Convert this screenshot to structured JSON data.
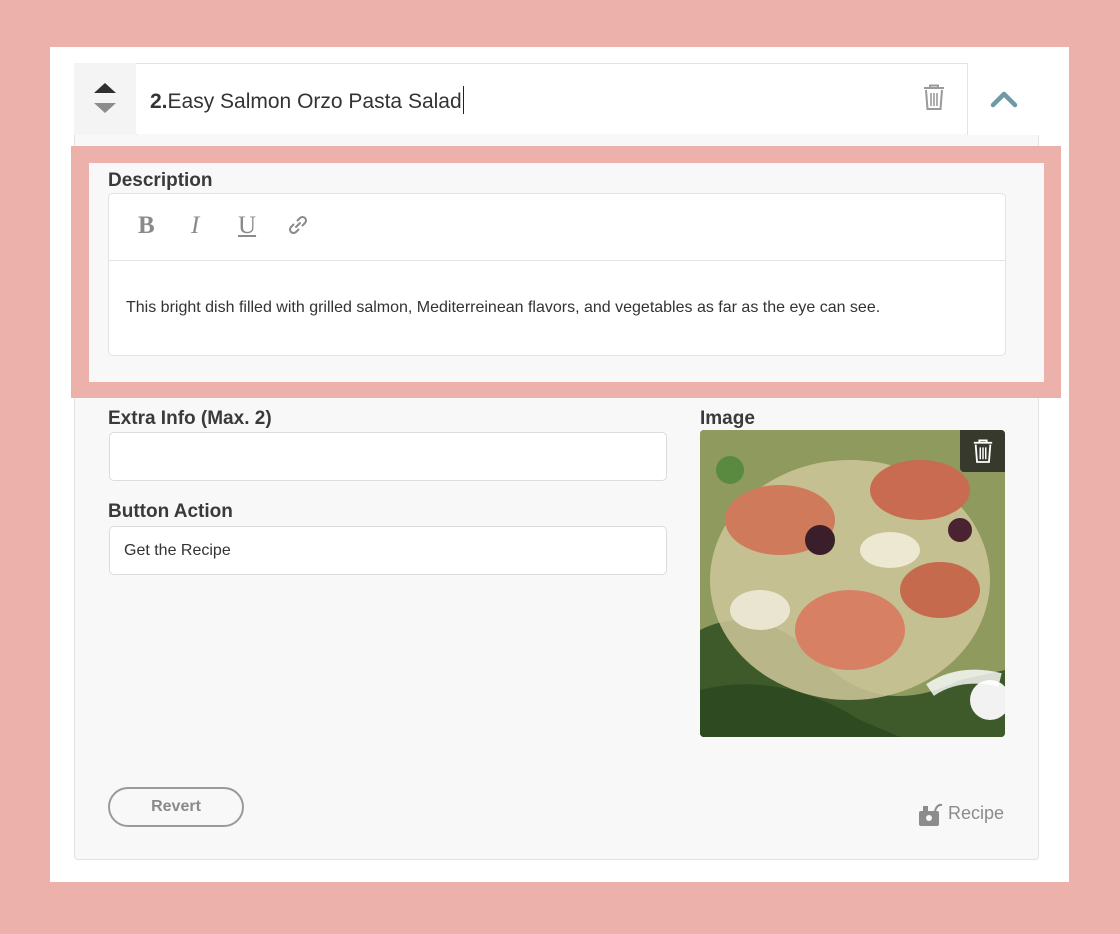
{
  "item": {
    "number": "2.",
    "title": "Easy Salmon Orzo Pasta Salad"
  },
  "description": {
    "label": "Description",
    "toolbar": {
      "bold": "B",
      "italic": "I",
      "underline": "U"
    },
    "text": "This bright dish filled with grilled salmon, Mediterreinean flavors, and vegetables as far as the eye can see."
  },
  "extra_info": {
    "label": "Extra Info (Max. 2)",
    "value": ""
  },
  "button_action": {
    "label": "Button Action",
    "value": "Get the Recipe"
  },
  "image": {
    "label": "Image"
  },
  "footer": {
    "revert_label": "Revert",
    "recipe_label": "Recipe"
  },
  "colors": {
    "background": "#ecb1ab",
    "highlight": "#ecb1ab",
    "chevron": "#6f9aa5"
  }
}
